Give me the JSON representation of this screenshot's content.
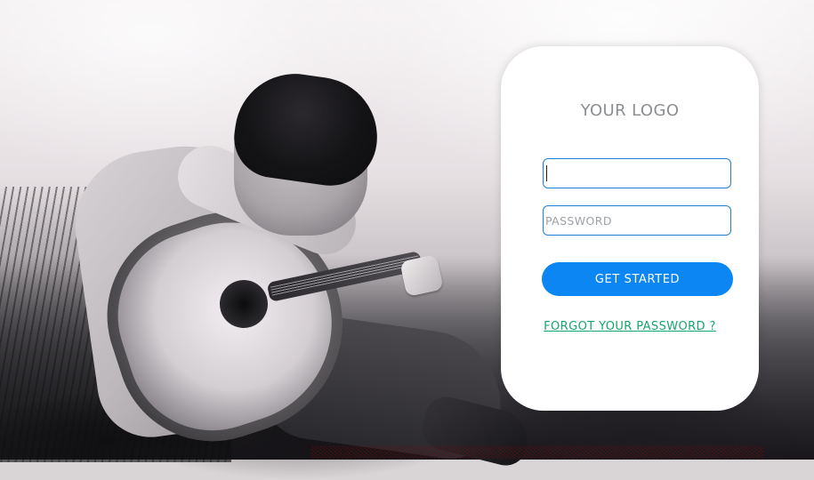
{
  "login_card": {
    "logo_text": "YOUR LOGO",
    "username": {
      "value": "",
      "placeholder": ""
    },
    "password": {
      "value": "",
      "placeholder": "PASSWORD"
    },
    "primary_button_label": "GET STARTED",
    "forgot_password_link": "FORGOT YOUR PASSWORD ?"
  },
  "background": {
    "bottom_overlay_text": "░░░░░░░░░░░░░░░░░░░░░░░░░░░░░░░░░░░░░░░░░░░░░░░░░░░░░░"
  },
  "colors": {
    "card_bg": "#ffffff",
    "input_border": "#1f7fd6",
    "button_bg": "#0b86f2",
    "link": "#17a56f",
    "logo_text": "#8b8f93"
  }
}
